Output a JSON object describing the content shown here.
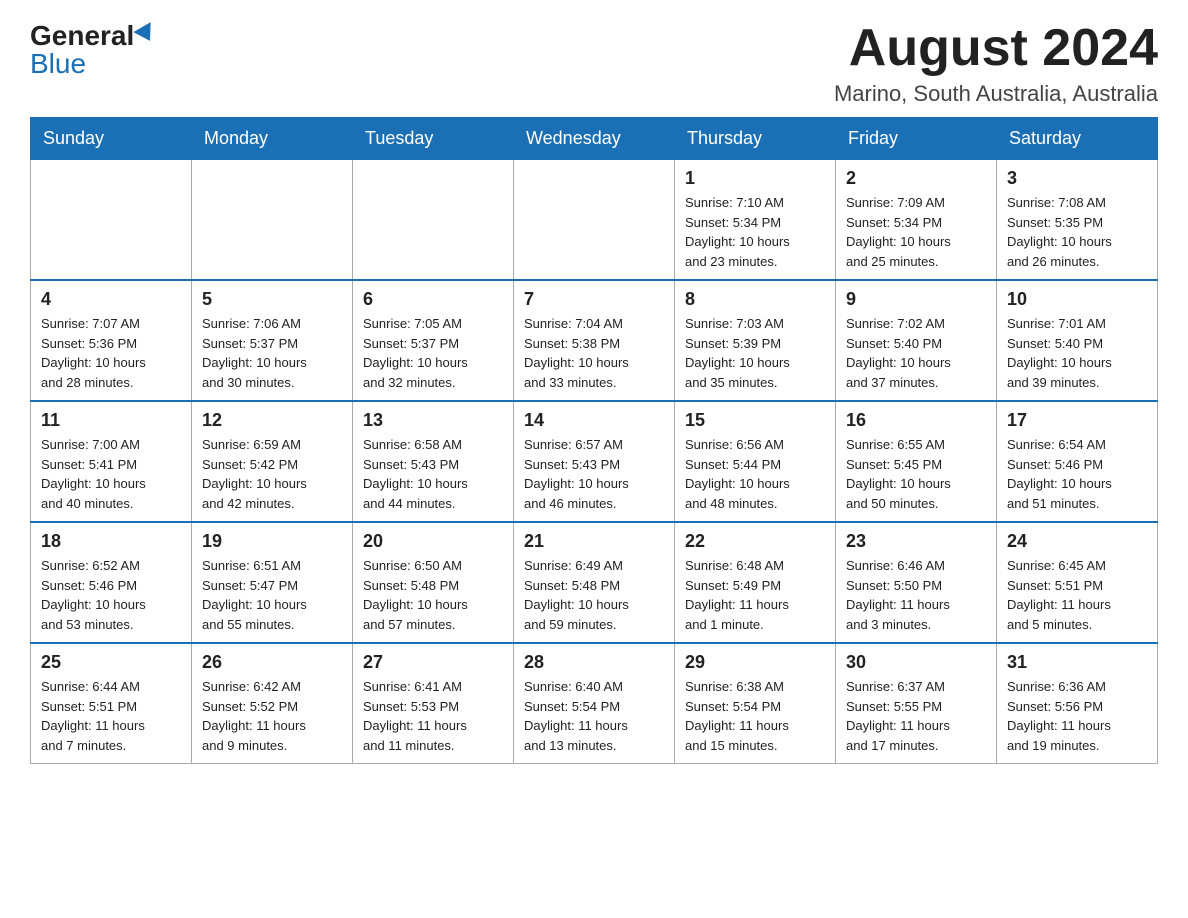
{
  "header": {
    "logo_general": "General",
    "logo_blue": "Blue",
    "month_title": "August 2024",
    "location": "Marino, South Australia, Australia"
  },
  "days_of_week": [
    "Sunday",
    "Monday",
    "Tuesday",
    "Wednesday",
    "Thursday",
    "Friday",
    "Saturday"
  ],
  "weeks": [
    [
      {
        "day": "",
        "info": ""
      },
      {
        "day": "",
        "info": ""
      },
      {
        "day": "",
        "info": ""
      },
      {
        "day": "",
        "info": ""
      },
      {
        "day": "1",
        "info": "Sunrise: 7:10 AM\nSunset: 5:34 PM\nDaylight: 10 hours\nand 23 minutes."
      },
      {
        "day": "2",
        "info": "Sunrise: 7:09 AM\nSunset: 5:34 PM\nDaylight: 10 hours\nand 25 minutes."
      },
      {
        "day": "3",
        "info": "Sunrise: 7:08 AM\nSunset: 5:35 PM\nDaylight: 10 hours\nand 26 minutes."
      }
    ],
    [
      {
        "day": "4",
        "info": "Sunrise: 7:07 AM\nSunset: 5:36 PM\nDaylight: 10 hours\nand 28 minutes."
      },
      {
        "day": "5",
        "info": "Sunrise: 7:06 AM\nSunset: 5:37 PM\nDaylight: 10 hours\nand 30 minutes."
      },
      {
        "day": "6",
        "info": "Sunrise: 7:05 AM\nSunset: 5:37 PM\nDaylight: 10 hours\nand 32 minutes."
      },
      {
        "day": "7",
        "info": "Sunrise: 7:04 AM\nSunset: 5:38 PM\nDaylight: 10 hours\nand 33 minutes."
      },
      {
        "day": "8",
        "info": "Sunrise: 7:03 AM\nSunset: 5:39 PM\nDaylight: 10 hours\nand 35 minutes."
      },
      {
        "day": "9",
        "info": "Sunrise: 7:02 AM\nSunset: 5:40 PM\nDaylight: 10 hours\nand 37 minutes."
      },
      {
        "day": "10",
        "info": "Sunrise: 7:01 AM\nSunset: 5:40 PM\nDaylight: 10 hours\nand 39 minutes."
      }
    ],
    [
      {
        "day": "11",
        "info": "Sunrise: 7:00 AM\nSunset: 5:41 PM\nDaylight: 10 hours\nand 40 minutes."
      },
      {
        "day": "12",
        "info": "Sunrise: 6:59 AM\nSunset: 5:42 PM\nDaylight: 10 hours\nand 42 minutes."
      },
      {
        "day": "13",
        "info": "Sunrise: 6:58 AM\nSunset: 5:43 PM\nDaylight: 10 hours\nand 44 minutes."
      },
      {
        "day": "14",
        "info": "Sunrise: 6:57 AM\nSunset: 5:43 PM\nDaylight: 10 hours\nand 46 minutes."
      },
      {
        "day": "15",
        "info": "Sunrise: 6:56 AM\nSunset: 5:44 PM\nDaylight: 10 hours\nand 48 minutes."
      },
      {
        "day": "16",
        "info": "Sunrise: 6:55 AM\nSunset: 5:45 PM\nDaylight: 10 hours\nand 50 minutes."
      },
      {
        "day": "17",
        "info": "Sunrise: 6:54 AM\nSunset: 5:46 PM\nDaylight: 10 hours\nand 51 minutes."
      }
    ],
    [
      {
        "day": "18",
        "info": "Sunrise: 6:52 AM\nSunset: 5:46 PM\nDaylight: 10 hours\nand 53 minutes."
      },
      {
        "day": "19",
        "info": "Sunrise: 6:51 AM\nSunset: 5:47 PM\nDaylight: 10 hours\nand 55 minutes."
      },
      {
        "day": "20",
        "info": "Sunrise: 6:50 AM\nSunset: 5:48 PM\nDaylight: 10 hours\nand 57 minutes."
      },
      {
        "day": "21",
        "info": "Sunrise: 6:49 AM\nSunset: 5:48 PM\nDaylight: 10 hours\nand 59 minutes."
      },
      {
        "day": "22",
        "info": "Sunrise: 6:48 AM\nSunset: 5:49 PM\nDaylight: 11 hours\nand 1 minute."
      },
      {
        "day": "23",
        "info": "Sunrise: 6:46 AM\nSunset: 5:50 PM\nDaylight: 11 hours\nand 3 minutes."
      },
      {
        "day": "24",
        "info": "Sunrise: 6:45 AM\nSunset: 5:51 PM\nDaylight: 11 hours\nand 5 minutes."
      }
    ],
    [
      {
        "day": "25",
        "info": "Sunrise: 6:44 AM\nSunset: 5:51 PM\nDaylight: 11 hours\nand 7 minutes."
      },
      {
        "day": "26",
        "info": "Sunrise: 6:42 AM\nSunset: 5:52 PM\nDaylight: 11 hours\nand 9 minutes."
      },
      {
        "day": "27",
        "info": "Sunrise: 6:41 AM\nSunset: 5:53 PM\nDaylight: 11 hours\nand 11 minutes."
      },
      {
        "day": "28",
        "info": "Sunrise: 6:40 AM\nSunset: 5:54 PM\nDaylight: 11 hours\nand 13 minutes."
      },
      {
        "day": "29",
        "info": "Sunrise: 6:38 AM\nSunset: 5:54 PM\nDaylight: 11 hours\nand 15 minutes."
      },
      {
        "day": "30",
        "info": "Sunrise: 6:37 AM\nSunset: 5:55 PM\nDaylight: 11 hours\nand 17 minutes."
      },
      {
        "day": "31",
        "info": "Sunrise: 6:36 AM\nSunset: 5:56 PM\nDaylight: 11 hours\nand 19 minutes."
      }
    ]
  ]
}
